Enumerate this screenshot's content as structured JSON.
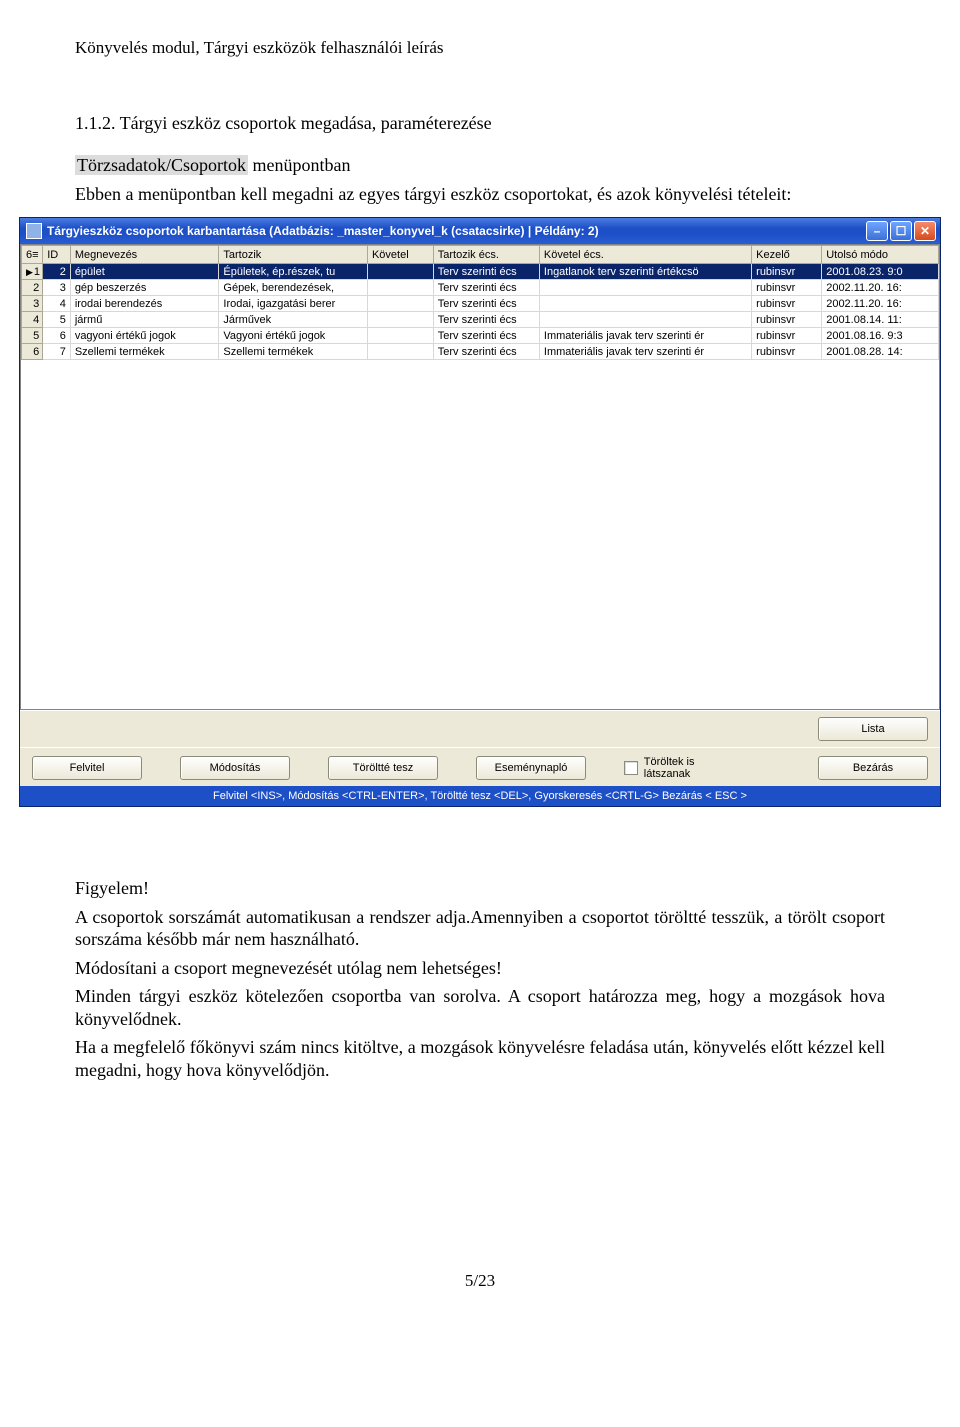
{
  "doc": {
    "header": "Könyvelés modul, Tárgyi eszközök felhasználói leírás",
    "section_number": "1.1.2. Tárgyi eszköz csoportok megadása, paraméterezése",
    "menu_path_label": "Törzsadatok/Csoportok",
    "menu_path_after": " menüpontban",
    "intro": "Ebben a menüpontban kell megadni az egyes tárgyi eszköz csoportokat, és azok könyvelési tételeit:",
    "attention": "Figyelem!",
    "p1": "A csoportok sorszámát automatikusan a rendszer adja.Amennyiben a csoportot töröltté tesszük, a törölt csoport sorszáma később már nem használható.",
    "p2": "Módosítani a csoport megnevezését utólag nem lehetséges!",
    "p3": "Minden tárgyi eszköz kötelezően csoportba van sorolva. A csoport határozza meg, hogy a mozgások hova könyvelődnek.",
    "p4": "Ha a megfelelő főkönyvi szám nincs kitöltve, a mozgások könyvelésre feladása után, könyvelés előtt kézzel kell megadni, hogy hova könyvelődjön.",
    "page_number": "5/23"
  },
  "window": {
    "title": "Tárgyieszköz csoportok karbantartása   (Adatbázis:  _master_konyvel_k (csatacsirke) | Példány: 2)",
    "columns": [
      "",
      "ID",
      "Megnevezés",
      "Tartozik",
      "Követel",
      "Tartozik écs.",
      "Követel écs.",
      "Kezelő",
      "Utolsó módo"
    ],
    "rows": [
      {
        "n": "1",
        "id": "2",
        "meg": "épület",
        "tart": "Épületek, ép.részek, tu",
        "kov": "",
        "tecs": "Terv szerinti écs",
        "kecs": "Ingatlanok terv szerinti értékcsö",
        "kez": "rubinsvr",
        "mod": "2001.08.23. 9:0"
      },
      {
        "n": "2",
        "id": "3",
        "meg": "gép beszerzés",
        "tart": "Gépek, berendezések,",
        "kov": "",
        "tecs": "Terv szerinti écs",
        "kecs": "",
        "kez": "rubinsvr",
        "mod": "2002.11.20. 16:"
      },
      {
        "n": "3",
        "id": "4",
        "meg": "irodai berendezés",
        "tart": "Irodai, igazgatási berer",
        "kov": "",
        "tecs": "Terv szerinti écs",
        "kecs": "",
        "kez": "rubinsvr",
        "mod": "2002.11.20. 16:"
      },
      {
        "n": "4",
        "id": "5",
        "meg": "jármű",
        "tart": "Járművek",
        "kov": "",
        "tecs": "Terv szerinti écs",
        "kecs": "",
        "kez": "rubinsvr",
        "mod": "2001.08.14. 11:"
      },
      {
        "n": "5",
        "id": "6",
        "meg": "vagyoni értékű jogok",
        "tart": "Vagyoni értékű jogok",
        "kov": "",
        "tecs": "Terv szerinti écs",
        "kecs": "Immateriális javak terv szerinti ér",
        "kez": "rubinsvr",
        "mod": "2001.08.16. 9:3"
      },
      {
        "n": "6",
        "id": "7",
        "meg": "Szellemi termékek",
        "tart": "Szellemi termékek",
        "kov": "",
        "tecs": "Terv szerinti écs",
        "kecs": "Immateriális javak terv szerinti ér",
        "kez": "rubinsvr",
        "mod": "2001.08.28. 14:"
      }
    ],
    "buttons": {
      "lista": "Lista",
      "felvitel": "Felvitel",
      "modositas": "Módosítás",
      "toroltte": "Töröltté tesz",
      "esemeny": "Eseménynapló",
      "torolt_lats": "Töröltek is látszanak",
      "bezaras": "Bezárás"
    },
    "statusbar": "Felvitel <INS>,  Módosítás <CTRL-ENTER>,  Töröltté tesz <DEL>,  Gyorskeresés <CRTL-G>  Bezárás < ESC >"
  }
}
